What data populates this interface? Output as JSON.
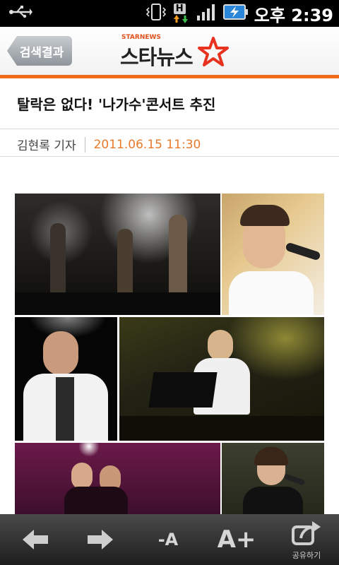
{
  "status_bar": {
    "time": "오후 2:39",
    "network": "H"
  },
  "header": {
    "back_label": "검색결과",
    "logo_small": "STARNEWS",
    "logo_main": "스타뉴스"
  },
  "article": {
    "headline": "탈락은 없다! '나가수'콘서트 추진",
    "reporter": "김현록 기자",
    "datetime": "2011.06.15 11:30"
  },
  "toolbar": {
    "font_smaller": "-A",
    "font_larger": "A+",
    "share_label": "공유하기"
  },
  "colors": {
    "accent": "#f06b1c",
    "date": "#e87a2a"
  }
}
